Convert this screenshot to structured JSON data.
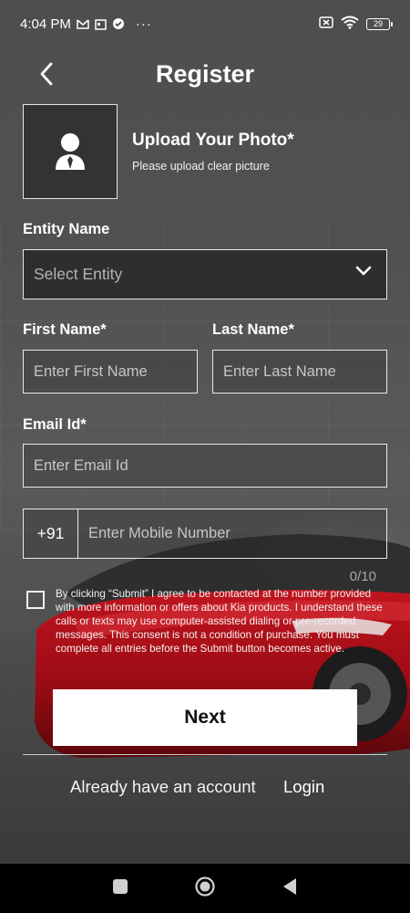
{
  "status_bar": {
    "time": "4:04 PM",
    "more": "···",
    "battery": "29"
  },
  "header": {
    "title": "Register"
  },
  "photo": {
    "title": "Upload Your Photo*",
    "subtitle": "Please upload clear picture"
  },
  "entity": {
    "label": "Entity Name",
    "placeholder": "Select Entity"
  },
  "first_name": {
    "label": "First Name*",
    "placeholder": "Enter First Name"
  },
  "last_name": {
    "label": "Last Name*",
    "placeholder": "Enter Last Name"
  },
  "email": {
    "label": "Email Id*",
    "placeholder": "Enter Email Id"
  },
  "mobile": {
    "country_code": "+91",
    "placeholder": "Enter Mobile Number",
    "counter": "0/10"
  },
  "consent": {
    "text": "By clicking “Submit” I agree to be contacted at the number provided with more information or offers about Kia products. I understand these calls or texts may use computer-assisted dialing or pre-recorded messages. This consent is not a condition of purchase. You must complete all entries before the Submit button becomes active.",
    "checked": false
  },
  "actions": {
    "next_label": "Next",
    "account_text": "Already have an account",
    "login_label": "Login"
  },
  "colors": {
    "background": "#4a4a4a",
    "car_red": "#b0101a",
    "button_bg": "#ffffff",
    "nav_bar": "#000000"
  }
}
